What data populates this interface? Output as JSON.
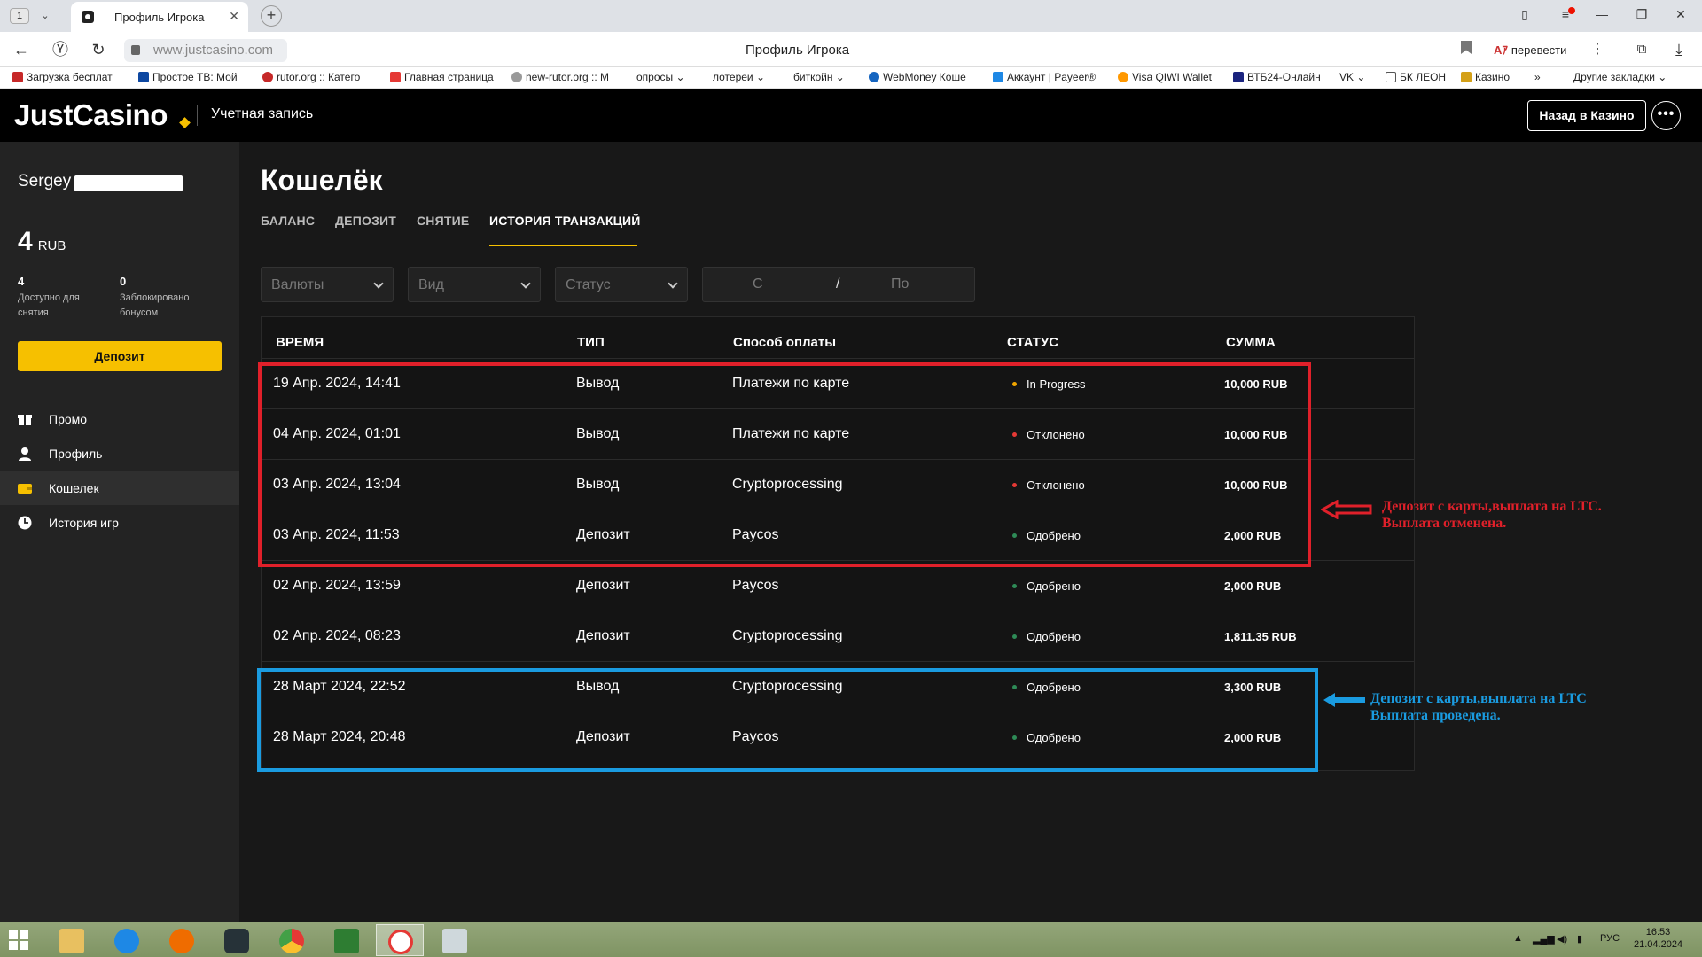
{
  "browser": {
    "tab_count": "1",
    "tab_title": "Профиль Игрока",
    "url": "www.justcasino.com",
    "page_title": "Профиль Игрока",
    "translate_label": "перевести",
    "bookmarks": [
      "Загрузка бесплат",
      "Простое ТВ: Мой",
      "rutor.org :: Катего",
      "Главная страница",
      "new-rutor.org :: M",
      "опросы",
      "лотереи",
      "биткойн",
      "WebMoney Коше",
      "Аккаунт | Payeer®",
      "Visa QIWI Wallet",
      "ВТБ24-Онлайн",
      "VK",
      "БК ЛЕОН",
      "Казино",
      "»",
      "Другие закладки"
    ]
  },
  "header": {
    "logo": "JustCasino",
    "account_label": "Учетная запись",
    "back_button": "Назад в Казино",
    "more_button": "•••"
  },
  "sidebar": {
    "user_first_name": "Sergey",
    "balance_amount": "4",
    "balance_currency": "RUB",
    "available_value": "4",
    "available_label": "Доступно для снятия",
    "blocked_value": "0",
    "blocked_label": "Заблокировано бонусом",
    "deposit_button": "Депозит",
    "nav": [
      {
        "label": "Промо",
        "icon": "gift-icon"
      },
      {
        "label": "Профиль",
        "icon": "user-icon"
      },
      {
        "label": "Кошелек",
        "icon": "wallet-icon"
      },
      {
        "label": "История игр",
        "icon": "clock-icon"
      }
    ],
    "active_nav": "Кошелек"
  },
  "main": {
    "title": "Кошелёк",
    "tabs": [
      "БАЛАНС",
      "ДЕПОЗИТ",
      "СНЯТИЕ",
      "ИСТОРИЯ ТРАНЗАКЦИЙ"
    ],
    "active_tab": "ИСТОРИЯ ТРАНЗАКЦИЙ",
    "filters": {
      "currency_placeholder": "Валюты",
      "type_placeholder": "Вид",
      "status_placeholder": "Статус",
      "date_from": "С",
      "date_sep": "/",
      "date_to": "По"
    },
    "columns": [
      "ВРЕМЯ",
      "ТИП",
      "Способ оплаты",
      "СТАТУС",
      "СУММА"
    ],
    "rows": [
      {
        "time": "19 Апр. 2024, 14:41",
        "type": "Вывод",
        "method": "Платежи по карте",
        "status": "In Progress",
        "status_color": "#f0a500",
        "amount": "10,000 RUB"
      },
      {
        "time": "04 Апр. 2024, 01:01",
        "type": "Вывод",
        "method": "Платежи по карте",
        "status": "Отклонено",
        "status_color": "#e53935",
        "amount": "10,000 RUB"
      },
      {
        "time": "03 Апр. 2024, 13:04",
        "type": "Вывод",
        "method": "Cryptoprocessing",
        "status": "Отклонено",
        "status_color": "#e53935",
        "amount": "10,000 RUB"
      },
      {
        "time": "03 Апр. 2024, 11:53",
        "type": "Депозит",
        "method": "Paycos",
        "status": "Одобрено",
        "status_color": "#2e8b57",
        "amount": "2,000 RUB"
      },
      {
        "time": "02 Апр. 2024, 13:59",
        "type": "Депозит",
        "method": "Paycos",
        "status": "Одобрено",
        "status_color": "#2e8b57",
        "amount": "2,000 RUB"
      },
      {
        "time": "02 Апр. 2024, 08:23",
        "type": "Депозит",
        "method": "Cryptoprocessing",
        "status": "Одобрено",
        "status_color": "#2e8b57",
        "amount": "1,811.35 RUB"
      },
      {
        "time": "28 Март 2024, 22:52",
        "type": "Вывод",
        "method": "Cryptoprocessing",
        "status": "Одобрено",
        "status_color": "#2e8b57",
        "amount": "3,300 RUB"
      },
      {
        "time": "28 Март 2024, 20:48",
        "type": "Депозит",
        "method": "Paycos",
        "status": "Одобрено",
        "status_color": "#2e8b57",
        "amount": "2,000 RUB"
      }
    ]
  },
  "annotations": {
    "red_line1": "Депозит с карты,выплата на LTC.",
    "red_line2": "Выплата отменена.",
    "red_color": "#e0202a",
    "blue_line1": "Депозит с карты,выплата на LTC",
    "blue_line2": "Выплата проведена.",
    "blue_color": "#1a9be0"
  },
  "taskbar": {
    "lang": "РУС",
    "time": "16:53",
    "date": "21.04.2024"
  },
  "colors": {
    "accent": "#f6c000",
    "background": "#181818",
    "sidebar": "#232323"
  }
}
